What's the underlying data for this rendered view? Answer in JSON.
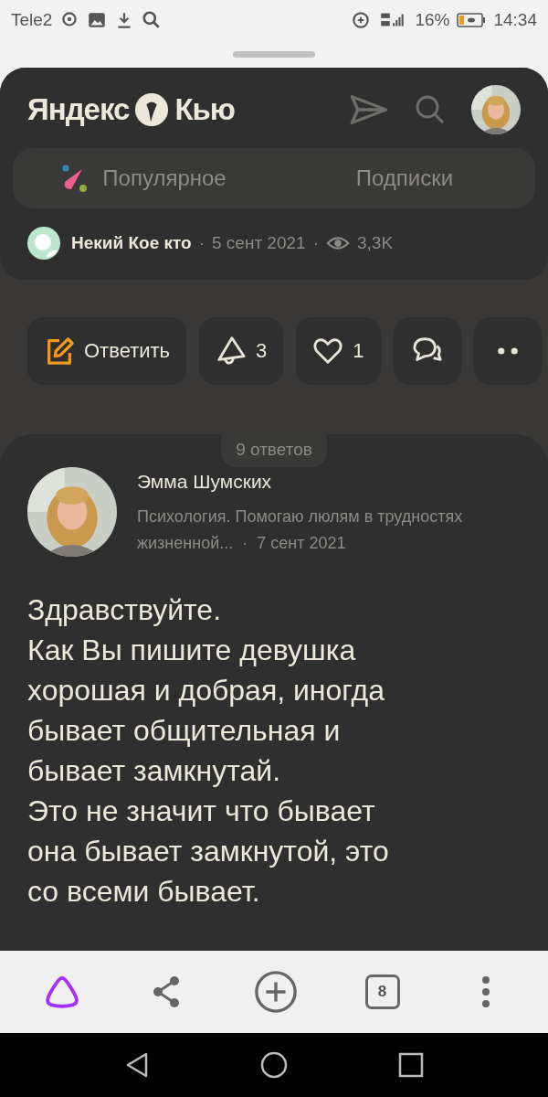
{
  "status_bar": {
    "carrier": "Tele2",
    "battery": "16%",
    "time": "14:34"
  },
  "header": {
    "logo_left": "Яндекс",
    "logo_right": "Кью"
  },
  "tabs": [
    {
      "label": "Популярное",
      "selected": false
    },
    {
      "label": "Подписки",
      "selected": false
    }
  ],
  "question": {
    "author": "Некий Кое кто",
    "separator_1": "·",
    "date": "5 сент 2021",
    "separator_2": "·",
    "views": "3,3K"
  },
  "actions": [
    {
      "kind": "reply",
      "label": "Ответить"
    },
    {
      "kind": "boost",
      "label": "3"
    },
    {
      "kind": "like",
      "label": "1"
    },
    {
      "kind": "comment"
    },
    {
      "kind": "more"
    }
  ],
  "answers_count": "9 ответов",
  "answer": {
    "author": "Эмма Шумских",
    "bio": "Психология. Помогаю люлям в трудностях жизненной...",
    "separator": "·",
    "date": "7 сент 2021",
    "text": "Здравствуйте.\nКак Вы пишите девушка\nхорошая и добрая, иногда\nбывает общительная и\nбывает замкнутай.\nЭто не значит что бывает\nона бывает замкнутой, это\nсо всеми бывает."
  },
  "browser_bar": {
    "tabs_count": "8"
  }
}
